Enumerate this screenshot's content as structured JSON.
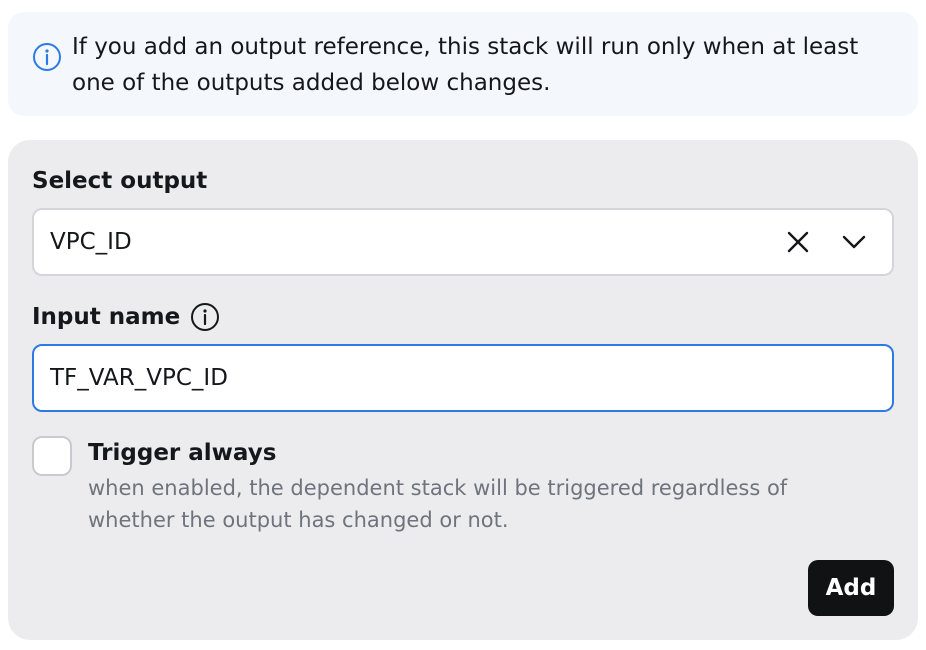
{
  "banner": {
    "icon": "info-icon",
    "text": "If you add an output reference, this stack will run only when at least one of the outputs added below changes."
  },
  "form": {
    "select_output": {
      "label": "Select output",
      "value": "VPC_ID",
      "clear_icon": "close-icon",
      "expand_icon": "chevron-down-icon"
    },
    "input_name": {
      "label": "Input name",
      "help_icon": "info-icon",
      "value": "TF_VAR_VPC_ID"
    },
    "trigger_always": {
      "label": "Trigger always",
      "checked": false,
      "description": "when enabled, the dependent stack will be triggered regardless of whether the output has changed or not."
    },
    "add_label": "Add"
  },
  "colors": {
    "banner_bg": "#f4f8fd",
    "info_icon": "#2c7be5",
    "card_bg": "#ececef",
    "focus_border": "#2c7be5",
    "primary_button": "#111214",
    "muted_text": "#70737d"
  }
}
